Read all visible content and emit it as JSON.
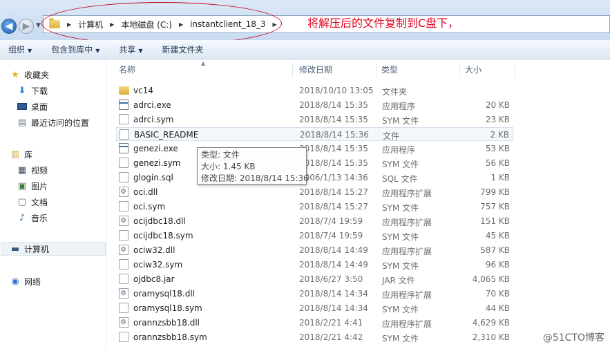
{
  "address": {
    "crumbs": [
      "计算机",
      "本地磁盘 (C:)",
      "instantclient_18_3"
    ]
  },
  "annotation": "将解压后的文件复制到C盘下，",
  "toolbar": {
    "organize": "组织",
    "include_library": "包含到库中",
    "share": "共享",
    "new_folder": "新建文件夹"
  },
  "sidebar": {
    "favorites": "收藏夹",
    "downloads": "下载",
    "desktop": "桌面",
    "recent": "最近访问的位置",
    "libraries": "库",
    "videos": "视频",
    "pictures": "图片",
    "documents": "文档",
    "music": "音乐",
    "computer": "计算机",
    "network": "网络"
  },
  "columns": {
    "name": "名称",
    "date": "修改日期",
    "type": "类型",
    "size": "大小"
  },
  "files": [
    {
      "name": "vc14",
      "date": "2018/10/10 13:05",
      "type": "文件夹",
      "size": "",
      "icon": "folder-icon"
    },
    {
      "name": "adrci.exe",
      "date": "2018/8/14 15:35",
      "type": "应用程序",
      "size": "20 KB",
      "icon": "exe-icon"
    },
    {
      "name": "adrci.sym",
      "date": "2018/8/14 15:35",
      "type": "SYM 文件",
      "size": "23 KB",
      "icon": "file-icon"
    },
    {
      "name": "BASIC_README",
      "date": "2018/8/14 15:36",
      "type": "文件",
      "size": "2 KB",
      "icon": "file-icon"
    },
    {
      "name": "genezi.exe",
      "date": "2018/8/14 15:35",
      "type": "应用程序",
      "size": "53 KB",
      "icon": "exe-icon"
    },
    {
      "name": "genezi.sym",
      "date": "2018/8/14 15:35",
      "type": "SYM 文件",
      "size": "56 KB",
      "icon": "file-icon"
    },
    {
      "name": "glogin.sql",
      "date": "2006/1/13 14:36",
      "type": "SQL 文件",
      "size": "1 KB",
      "icon": "file-icon"
    },
    {
      "name": "oci.dll",
      "date": "2018/8/14 15:27",
      "type": "应用程序扩展",
      "size": "799 KB",
      "icon": "dll-icon"
    },
    {
      "name": "oci.sym",
      "date": "2018/8/14 15:27",
      "type": "SYM 文件",
      "size": "757 KB",
      "icon": "file-icon"
    },
    {
      "name": "ocijdbc18.dll",
      "date": "2018/7/4 19:59",
      "type": "应用程序扩展",
      "size": "151 KB",
      "icon": "dll-icon"
    },
    {
      "name": "ocijdbc18.sym",
      "date": "2018/7/4 19:59",
      "type": "SYM 文件",
      "size": "45 KB",
      "icon": "file-icon"
    },
    {
      "name": "ociw32.dll",
      "date": "2018/8/14 14:49",
      "type": "应用程序扩展",
      "size": "587 KB",
      "icon": "dll-icon"
    },
    {
      "name": "ociw32.sym",
      "date": "2018/8/14 14:49",
      "type": "SYM 文件",
      "size": "96 KB",
      "icon": "file-icon"
    },
    {
      "name": "ojdbc8.jar",
      "date": "2018/6/27 3:50",
      "type": "JAR 文件",
      "size": "4,065 KB",
      "icon": "file-icon"
    },
    {
      "name": "oramysql18.dll",
      "date": "2018/8/14 14:34",
      "type": "应用程序扩展",
      "size": "70 KB",
      "icon": "dll-icon"
    },
    {
      "name": "oramysql18.sym",
      "date": "2018/8/14 14:34",
      "type": "SYM 文件",
      "size": "44 KB",
      "icon": "file-icon"
    },
    {
      "name": "orannzsbb18.dll",
      "date": "2018/2/21 4:41",
      "type": "应用程序扩展",
      "size": "4,629 KB",
      "icon": "dll-icon"
    },
    {
      "name": "orannzsbb18.sym",
      "date": "2018/2/21 4:42",
      "type": "SYM 文件",
      "size": "2,310 KB",
      "icon": "file-icon"
    }
  ],
  "tooltip": {
    "type_line": "类型: 文件",
    "size_line": "大小: 1.45 KB",
    "date_line": "修改日期: 2018/8/14 15:36"
  },
  "watermark": "@51CTO博客"
}
